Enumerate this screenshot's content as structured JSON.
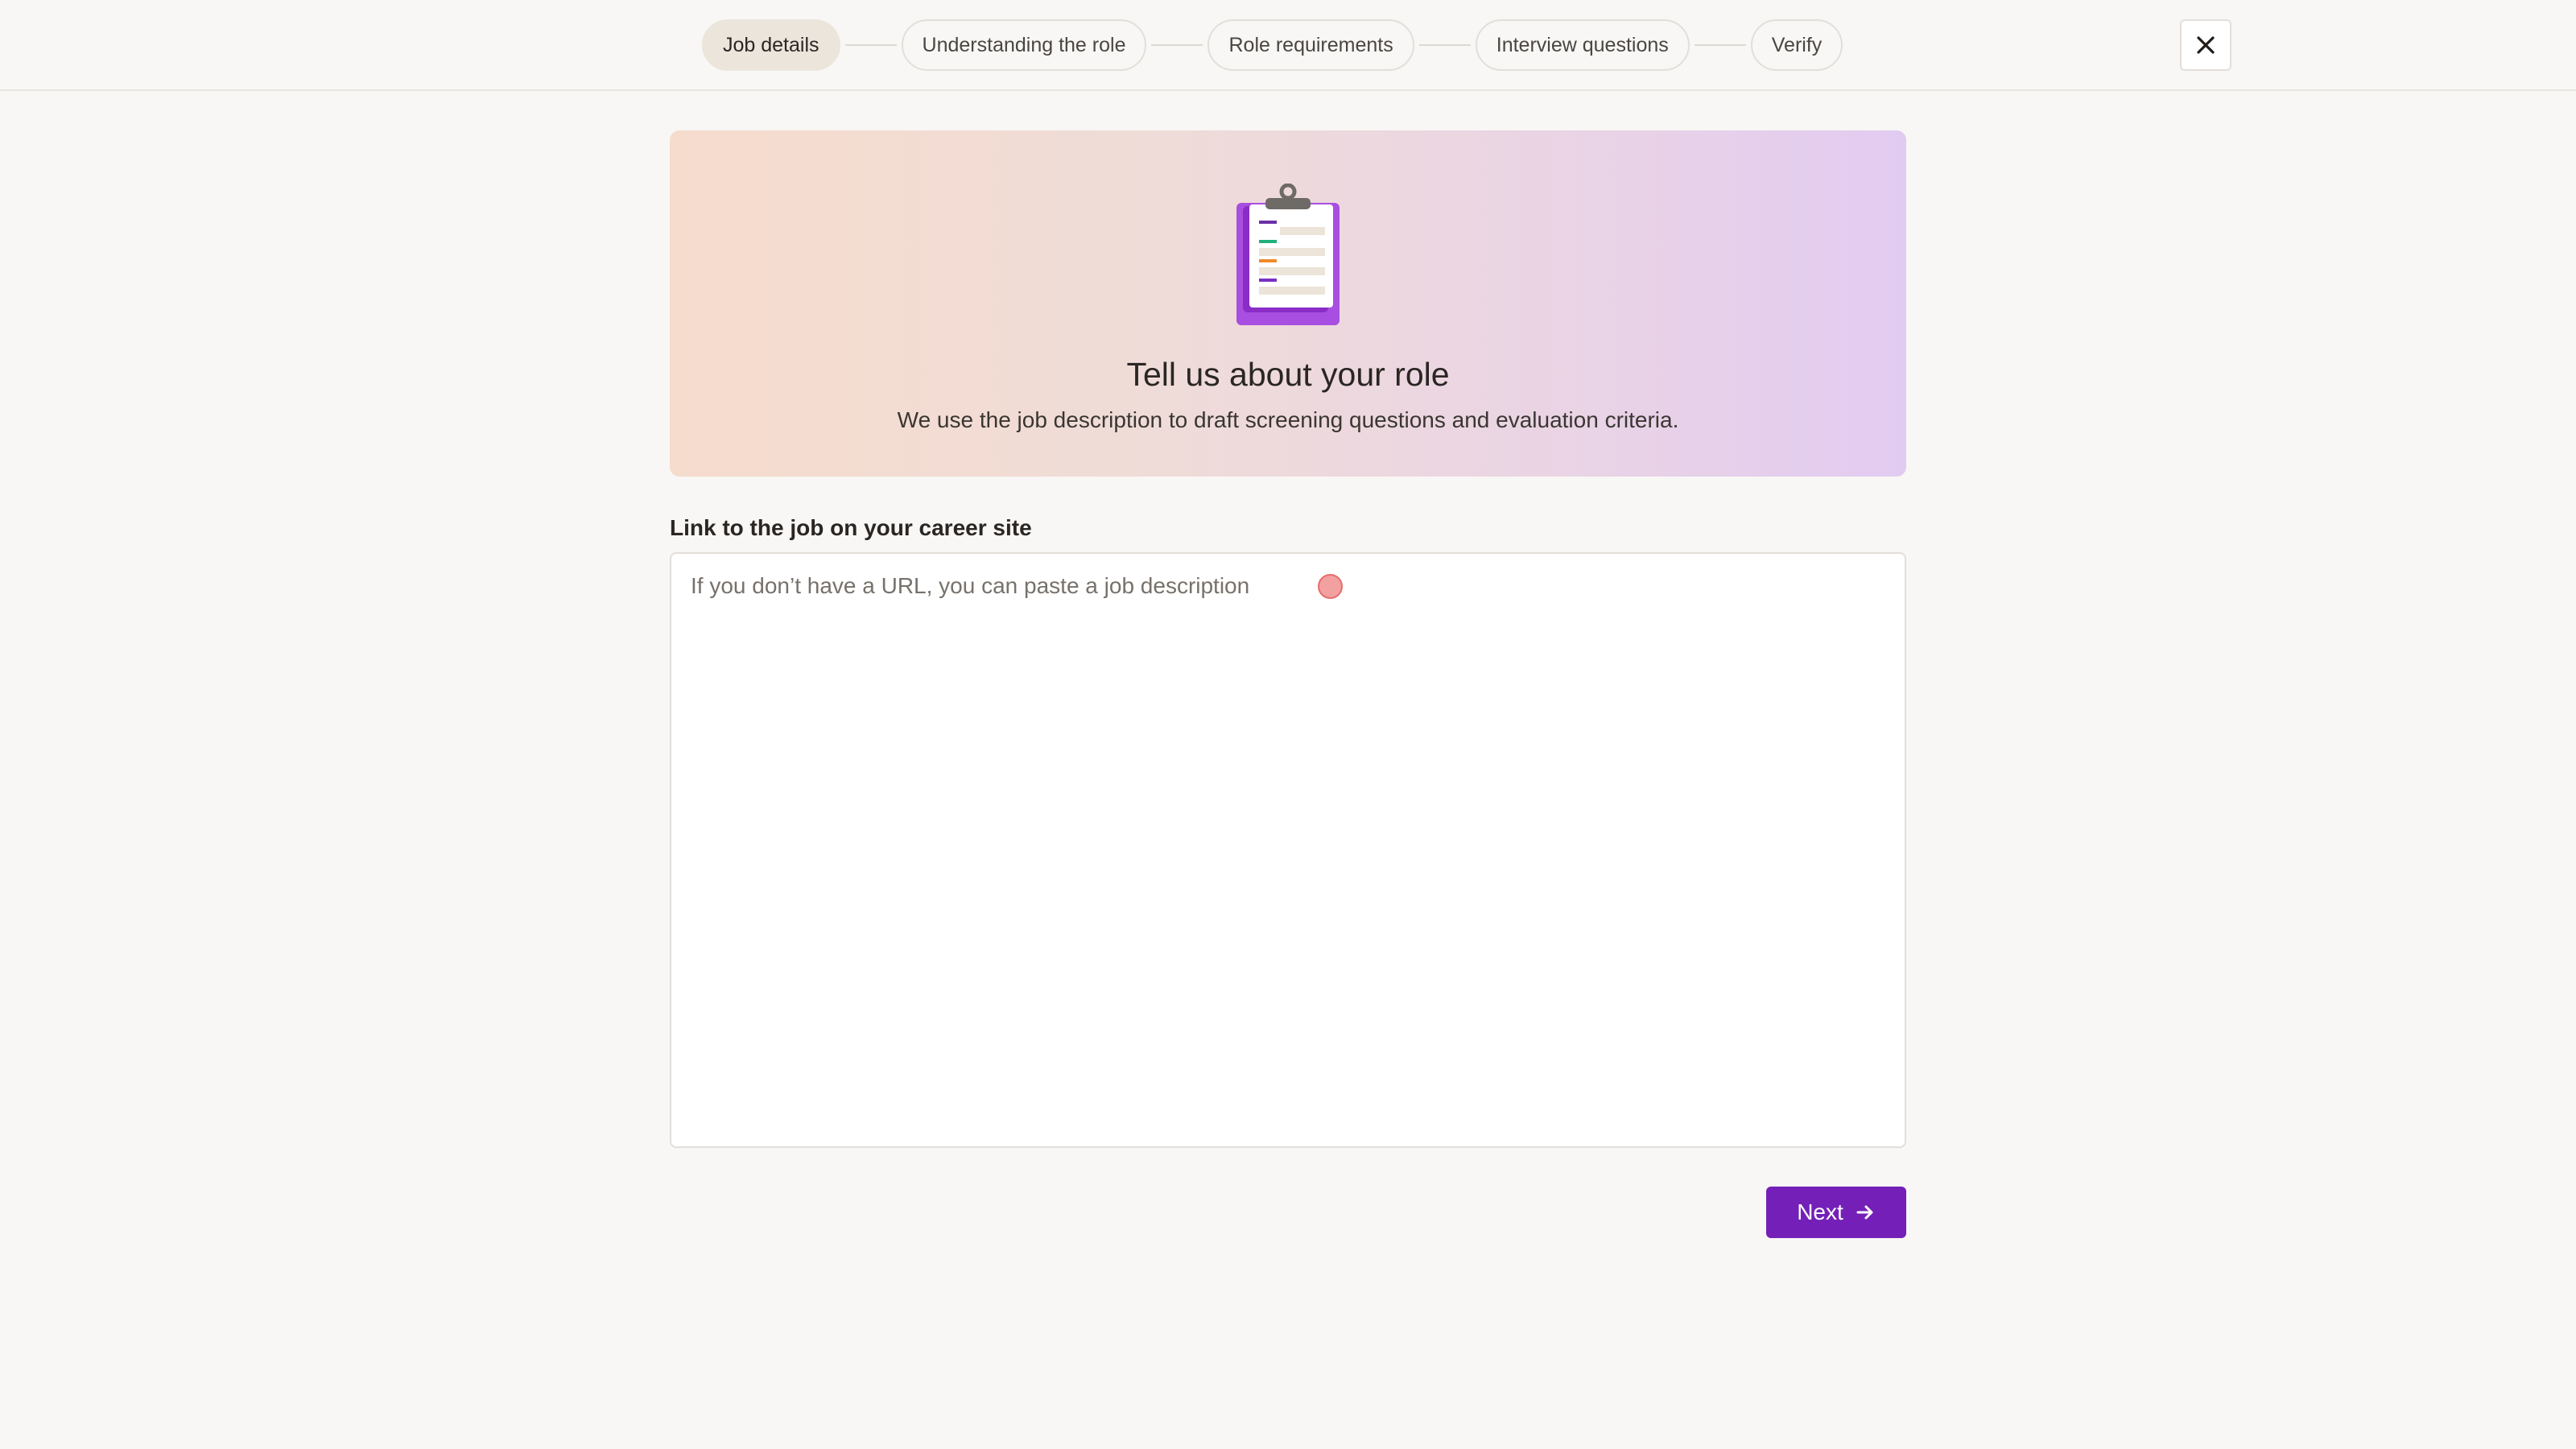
{
  "stepper": {
    "steps": [
      {
        "label": "Job details",
        "active": true
      },
      {
        "label": "Understanding the role",
        "active": false
      },
      {
        "label": "Role requirements",
        "active": false
      },
      {
        "label": "Interview questions",
        "active": false
      },
      {
        "label": "Verify",
        "active": false
      }
    ],
    "close_icon": "close-icon"
  },
  "hero": {
    "icon": "clipboard-icon",
    "title": "Tell us about your role",
    "subtitle": "We use the job description to draft screening questions and evaluation criteria."
  },
  "form": {
    "label": "Link to the job on your career site",
    "value": "",
    "placeholder": "If you don’t have a URL, you can paste a job description"
  },
  "actions": {
    "next_label": "Next",
    "next_icon": "arrow-right-icon"
  },
  "colors": {
    "accent": "#7420b8",
    "active_step_bg": "#ebe5dc",
    "page_bg": "#f8f7f5"
  }
}
